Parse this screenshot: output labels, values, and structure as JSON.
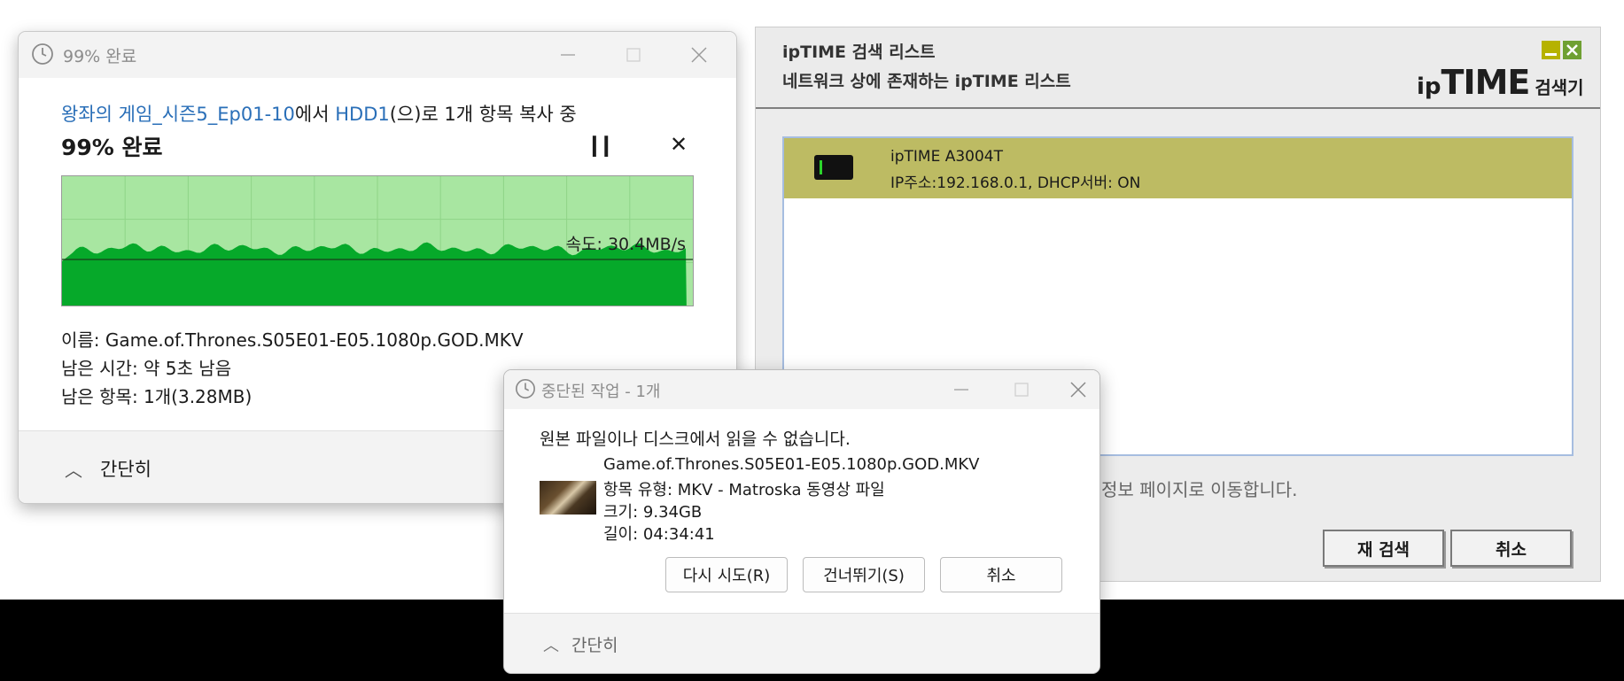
{
  "copy_dialog": {
    "title": "99% 완료",
    "source_folder": "왕좌의 게임_시즌5_Ep01-10",
    "from_text": "에서 ",
    "destination": "HDD1",
    "progress_text": "(으)로 1개 항목 복사 중",
    "percent_label": "99% 완료",
    "progress_fraction": 0.99,
    "speed_label": "속도: 30.4MB/s",
    "name_line": "이름: Game.of.Thrones.S05E01-E05.1080p.GOD.MKV",
    "time_remaining": "남은 시간: 약 5초 남음",
    "items_remaining": "남은 항목: 1개(3.28MB)",
    "collapse_label": "간단히",
    "colors": {
      "link": "#2a6fb8",
      "graph_bg": "#a8e6a1",
      "graph_fill": "#06a92a"
    }
  },
  "iptime": {
    "title": "ipTIME 검색 리스트",
    "subtitle": "네트워크 상에 존재하는 ipTIME 리스트",
    "logo_ip": "ip",
    "logo_time": "TIME",
    "logo_suffix": "검색기",
    "devices": [
      {
        "name": "ipTIME A3004T",
        "detail": "IP주소:192.168.0.1,  DHCP서버: ON"
      }
    ],
    "footer_message": "정보 페이지로 이동합니다.",
    "rescan_label": "재 검색",
    "cancel_label": "취소",
    "colors": {
      "selected_row": "#bdbb63",
      "minimize": "#b6b200",
      "close": "#6fa032"
    }
  },
  "interrupted_dialog": {
    "title": "중단된 작업 - 1개",
    "error_message": "원본 파일이나 디스크에서 읽을 수 없습니다.",
    "file_name": "Game.of.Thrones.S05E01-E05.1080p.GOD.MKV",
    "file_type": "항목 유형: MKV - Matroska 동영상 파일",
    "file_size": "크기: 9.34GB",
    "duration": "길이: 04:34:41",
    "retry_label": "다시 시도(R)",
    "skip_label": "건너뛰기(S)",
    "cancel_label": "취소",
    "collapse_label": "간단히"
  }
}
